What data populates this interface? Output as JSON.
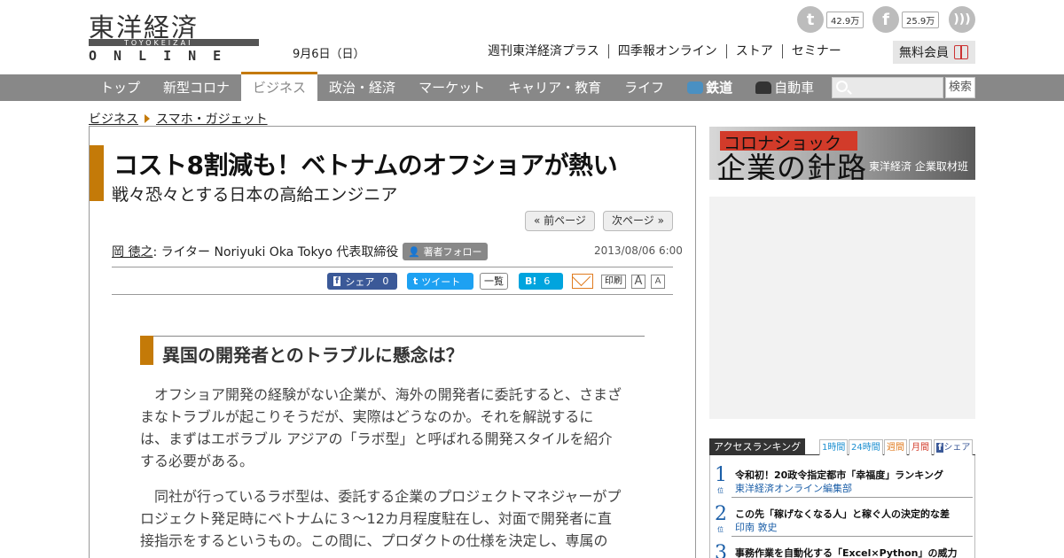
{
  "header": {
    "logo_kanji": "東洋経済",
    "logo_roman": "ONLINE",
    "logo_sub": "TOYOKEIZAI",
    "date": "9月6日（日）",
    "social": [
      {
        "icon": "twitter-icon",
        "count": "42.9万"
      },
      {
        "icon": "facebook-icon",
        "count": "25.9万"
      },
      {
        "icon": "rss-icon"
      }
    ],
    "links": [
      "週刊東洋経済プラス",
      "四季報オンライン",
      "ストア",
      "セミナー"
    ],
    "member_label": "無料会員"
  },
  "nav": {
    "items": [
      "トップ",
      "新型コロナ",
      "ビジネス",
      "政治・経済",
      "マーケット",
      "キャリア・教育",
      "ライフ",
      "鉄道",
      "自動車"
    ],
    "active": "ビジネス",
    "search_label": "検索"
  },
  "breadcrumb": [
    "ビジネス",
    "スマホ・ガジェット"
  ],
  "article": {
    "title": "コスト8割減も！ベトナムのオフショアが熱い",
    "subtitle": "戦々恐々とする日本の高給エンジニア",
    "prev_label": "« 前ページ",
    "next_label": "次ページ »",
    "author": "岡 徳之",
    "author_role": " : ライター Noriyuki Oka Tokyo 代表取締役",
    "follow_label": "著者フォロー",
    "date": "2013/08/06 6:00",
    "share": {
      "fb_label": "シェア",
      "fb_count": "0",
      "tw_label": "ツイート",
      "list_label": "一覧",
      "hb_label": "B!",
      "hb_count": "6",
      "print_label": "印刷",
      "font_big": "A",
      "font_small": "A"
    },
    "heading": "異国の開発者とのトラブルに懸念は？",
    "paragraphs": [
      [
        "　オフショア開発の経験がない企業が、海外の開発者に委託すると、さまざ",
        "まなトラブルが起こりそうだが、実際はどうなのか。それを解説するに",
        "は、まずはエボラブル アジアの「ラボ型」と呼ばれる開発スタイルを紹介",
        "する必要がある。"
      ],
      [
        "　同社が行っているラボ型は、委託する企業のプロジェクトマネジャーがプ",
        "ロジェクト発足時にベトナムに３〜12カ月程度駐在し、対面で開発者に直",
        "接指示をするというもの。この間に、プロダクトの仕様を決定し、専属の"
      ]
    ]
  },
  "sidebar": {
    "banner": {
      "top": "コロナショック",
      "main": "企業の針路",
      "credit": "東洋経済 企業取材班"
    },
    "ranking": {
      "label": "アクセスランキング",
      "tabs": [
        "1時間",
        "24時間",
        "週間",
        "月間",
        "シェア"
      ],
      "pos_label": "位",
      "items": [
        {
          "rank": "1",
          "title": "令和初！20政令指定都市「幸福度」ランキング",
          "by": "東洋経済オンライン編集部"
        },
        {
          "rank": "2",
          "title": "この先「稼げなくなる人」と稼ぐ人の決定的な差",
          "by": "印南 敦史"
        },
        {
          "rank": "3",
          "title": "事務作業を自動化する「Excel×Python」の威力",
          "by": ""
        }
      ]
    }
  }
}
